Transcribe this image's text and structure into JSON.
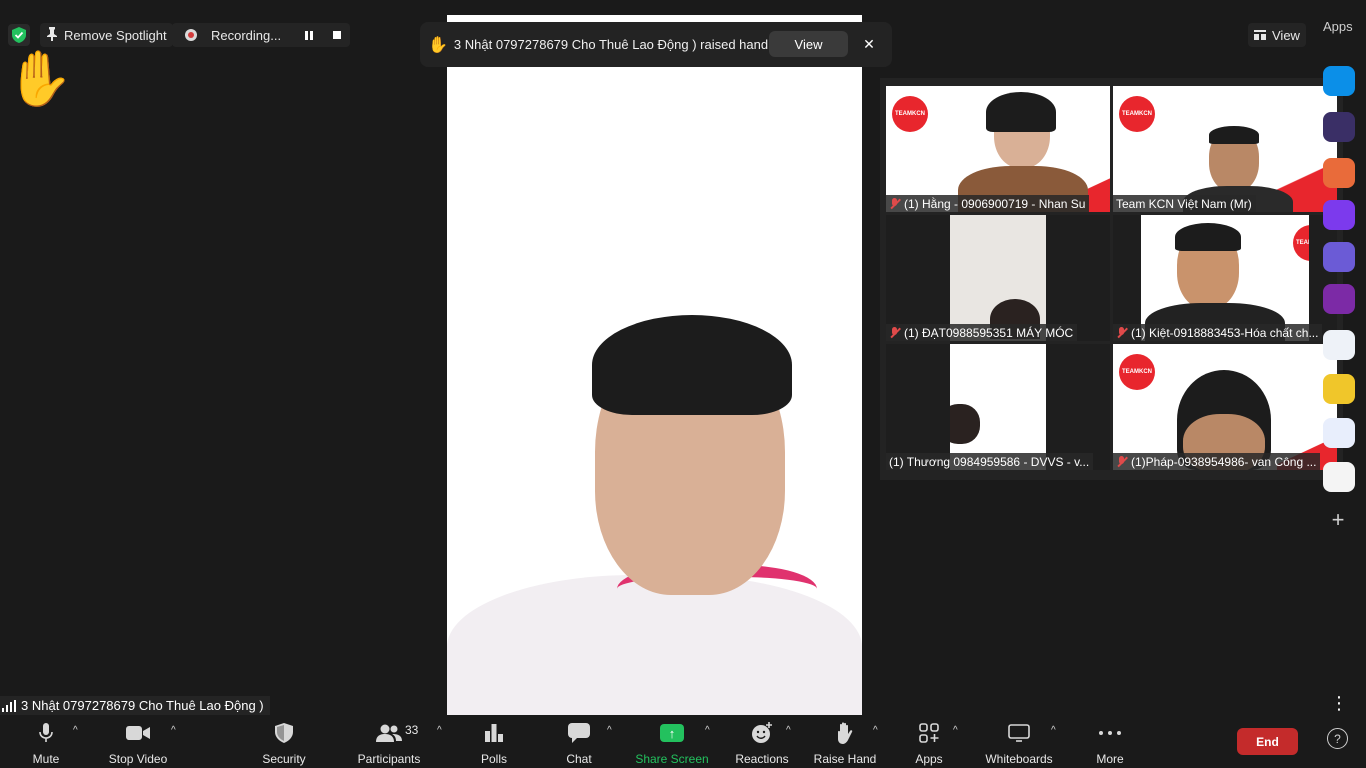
{
  "top_bar": {
    "spotlight_label": "Remove Spotlight",
    "recording_label": "Recording...",
    "view_label": "View",
    "apps_label": "Apps"
  },
  "notification": {
    "text": "3 Nhật 0797278679 Cho Thuê Lao Động ) raised hand",
    "view_button": "View"
  },
  "gallery": {
    "tiles": [
      {
        "name": "(1) Hằng - 0906900719 - Nhan Su",
        "muted": true
      },
      {
        "name": "Team KCN Việt Nam (Mr)",
        "muted": false
      },
      {
        "name": "(1) ĐẠT0988595351 MÁY MÓC",
        "muted": true
      },
      {
        "name": "(1) Kiệt-0918883453-Hóa chất ch...",
        "muted": true
      },
      {
        "name": "(1) Thương 0984959586 - DVVS - v...",
        "muted": false
      },
      {
        "name": "(1)Pháp-0938954986- van Công ...",
        "muted": true
      }
    ],
    "logo_text": "TEAMKCN"
  },
  "speaker": {
    "name": "3 Nhật 0797278679 Cho Thuê Lao Động )"
  },
  "toolbar": {
    "mute": "Mute",
    "stop_video": "Stop Video",
    "security": "Security",
    "participants": "Participants",
    "participants_count": "33",
    "polls": "Polls",
    "chat": "Chat",
    "share_screen": "Share Screen",
    "reactions": "Reactions",
    "raise_hand": "Raise Hand",
    "apps": "Apps",
    "whiteboards": "Whiteboards",
    "more": "More",
    "end": "End"
  },
  "colors": {
    "accent_green": "#23c15e",
    "end_red": "#c42b2b",
    "brand_red": "#e8262d"
  }
}
